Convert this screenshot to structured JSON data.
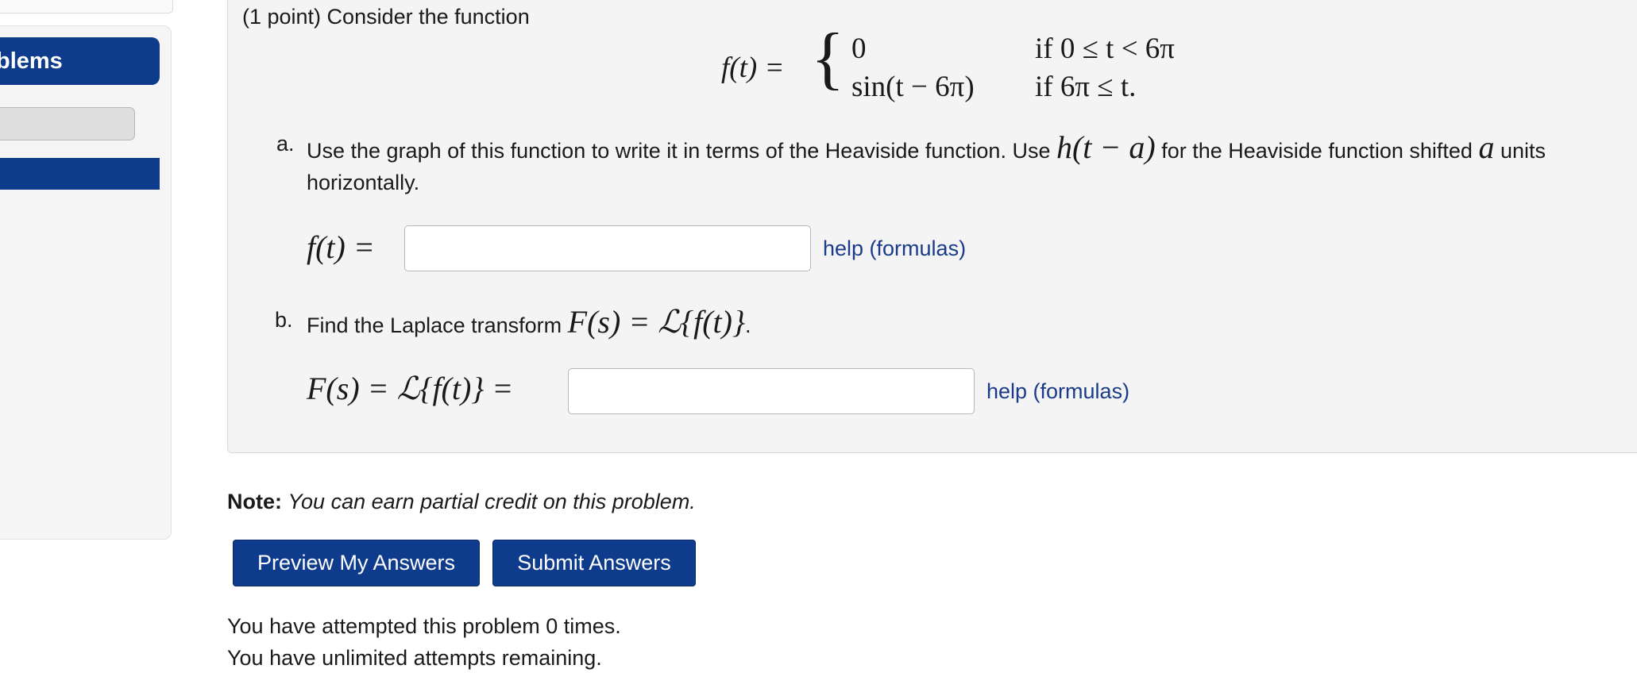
{
  "sidebar": {
    "problems_label": "blems",
    "partial_glyph": ")"
  },
  "problem": {
    "intro": "(1 point) Consider the function",
    "piecewise": {
      "lhs": "f(t) =",
      "case1_value": "0",
      "case1_condition": "if 0 ≤ t < 6π",
      "case2_value": "sin(t − 6π)",
      "case2_condition": "if 6π ≤ t."
    },
    "part_a": {
      "label": "a.",
      "text_before": "Use the graph of this function to write it in terms of the Heaviside function. Use ",
      "heaviside_expr": "h(t − a)",
      "text_middle": " for the Heaviside function shifted ",
      "shift_var": "a",
      "text_after": " units horizontally.",
      "answer_lhs": "f(t) =",
      "answer_value": "",
      "help_label": "help (formulas)"
    },
    "part_b": {
      "label": "b.",
      "text": "Find the Laplace transform ",
      "expr": "F(s) = ℒ{f(t)}",
      "text_end": ".",
      "answer_lhs": "F(s) = ℒ{f(t)} =",
      "answer_value": "",
      "help_label": "help (formulas)"
    }
  },
  "note": {
    "label": "Note:",
    "text": "You can earn partial credit on this problem."
  },
  "buttons": {
    "preview": "Preview My Answers",
    "submit": "Submit Answers"
  },
  "attempts": {
    "line1": "You have attempted this problem 0 times.",
    "line2": "You have unlimited attempts remaining."
  },
  "colors": {
    "accent": "#0f3b8c",
    "link": "#1a3a8a",
    "panel_bg": "#f4f4f4"
  }
}
